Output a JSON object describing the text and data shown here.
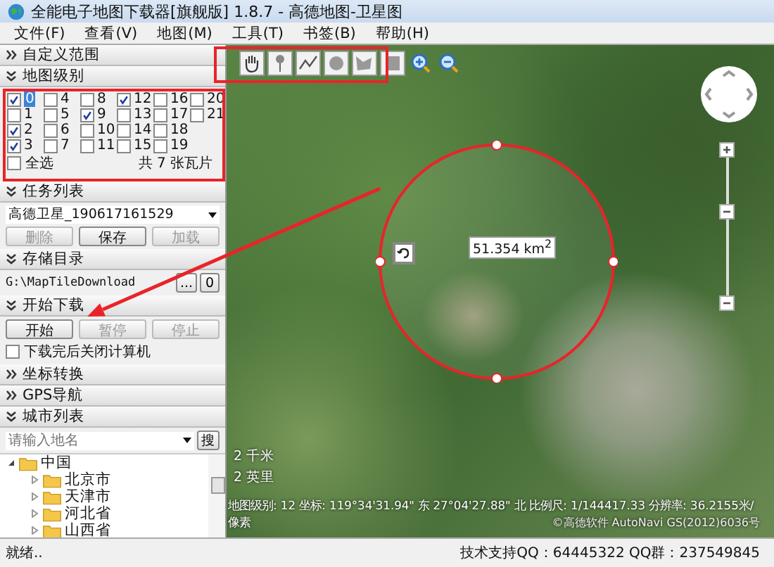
{
  "window": {
    "title": "全能电子地图下载器[旗舰版] 1.8.7 - 高德地图-卫星图"
  },
  "menu": [
    "文件(F)",
    "查看(V)",
    "地图(M)",
    "工具(T)",
    "书签(B)",
    "帮助(H)"
  ],
  "sections": [
    {
      "kind": "header",
      "title": "自定义范围",
      "expanded": false
    },
    {
      "kind": "levels",
      "title": "地图级别",
      "expanded": true,
      "levels": [
        {
          "label": "0",
          "checked": true,
          "selected": true
        },
        {
          "label": "1",
          "checked": false,
          "selected": false
        },
        {
          "label": "2",
          "checked": true,
          "selected": false
        },
        {
          "label": "3",
          "checked": true,
          "selected": false
        },
        {
          "label": "4",
          "checked": false,
          "selected": false
        },
        {
          "label": "5",
          "checked": false,
          "selected": false
        },
        {
          "label": "6",
          "checked": false,
          "selected": false
        },
        {
          "label": "7",
          "checked": false,
          "selected": false
        },
        {
          "label": "8",
          "checked": false,
          "selected": false
        },
        {
          "label": "9",
          "checked": true,
          "selected": false
        },
        {
          "label": "10",
          "checked": false,
          "selected": false
        },
        {
          "label": "11",
          "checked": false,
          "selected": false
        },
        {
          "label": "12",
          "checked": true,
          "selected": false
        },
        {
          "label": "13",
          "checked": false,
          "selected": false
        },
        {
          "label": "14",
          "checked": false,
          "selected": false
        },
        {
          "label": "15",
          "checked": false,
          "selected": false
        },
        {
          "label": "16",
          "checked": false,
          "selected": false
        },
        {
          "label": "17",
          "checked": false,
          "selected": false
        },
        {
          "label": "18",
          "checked": false,
          "selected": false
        },
        {
          "label": "19",
          "checked": false,
          "selected": false
        },
        {
          "label": "20",
          "checked": false,
          "selected": false
        },
        {
          "label": "21",
          "checked": false,
          "selected": false
        }
      ],
      "select_all": {
        "label": "全选",
        "checked": false
      },
      "tile_count": "共 7 张瓦片"
    },
    {
      "kind": "tasks",
      "title": "任务列表",
      "expanded": true,
      "task": "高德卫星_190617161529",
      "buttons": [
        {
          "label": "删除",
          "disabled": true
        },
        {
          "label": "保存",
          "disabled": false
        },
        {
          "label": "加载",
          "disabled": true
        }
      ]
    },
    {
      "kind": "folder",
      "title": "存储目录",
      "expanded": true,
      "path": "G:\\MapTileDownload",
      "buttons": [
        "...",
        "0"
      ]
    },
    {
      "kind": "download",
      "title": "开始下载",
      "expanded": true,
      "buttons": [
        {
          "label": "开始",
          "disabled": false
        },
        {
          "label": "暂停",
          "disabled": true
        },
        {
          "label": "停止",
          "disabled": true
        }
      ],
      "shutdown": {
        "label": "下载完后关闭计算机",
        "checked": false
      }
    },
    {
      "kind": "header",
      "title": "坐标转换",
      "expanded": false
    },
    {
      "kind": "header",
      "title": "GPS导航",
      "expanded": false
    },
    {
      "kind": "cities",
      "title": "城市列表",
      "expanded": true,
      "search": {
        "placeholder": "请输入地名"
      },
      "search_button": "搜",
      "tree": [
        {
          "label": "中国",
          "expanded": true,
          "children": [
            {
              "label": "北京市",
              "expanded": false
            },
            {
              "label": "天津市",
              "expanded": false
            },
            {
              "label": "河北省",
              "expanded": false
            },
            {
              "label": "山西省",
              "expanded": false
            }
          ]
        }
      ]
    }
  ],
  "map": {
    "tools": [
      {
        "kind": "hand"
      },
      {
        "kind": "pin"
      },
      {
        "kind": "polyline"
      },
      {
        "kind": "circle"
      },
      {
        "kind": "polygon"
      },
      {
        "kind": "rectangle"
      },
      {
        "kind": "zoom-in"
      },
      {
        "kind": "zoom-out"
      }
    ],
    "zoom": {
      "level": 0.6
    },
    "measurement": "51.354 km$^{2}$",
    "scale": [
      "2 千米",
      "2 英里"
    ],
    "info": "地图级别: 12 坐标: 119°34'31.94\" 东 27°04'27.88\" 北 比例尺: 1/144417.33 分辨率: 36.2155米/",
    "info_2": "像素",
    "copyright": "©高德软件 AutoNavi GS(2012)6036号"
  },
  "status_bar": {
    "text": "就绪..",
    "support": "技术支持QQ：64445322 QQ群：237549845"
  }
}
